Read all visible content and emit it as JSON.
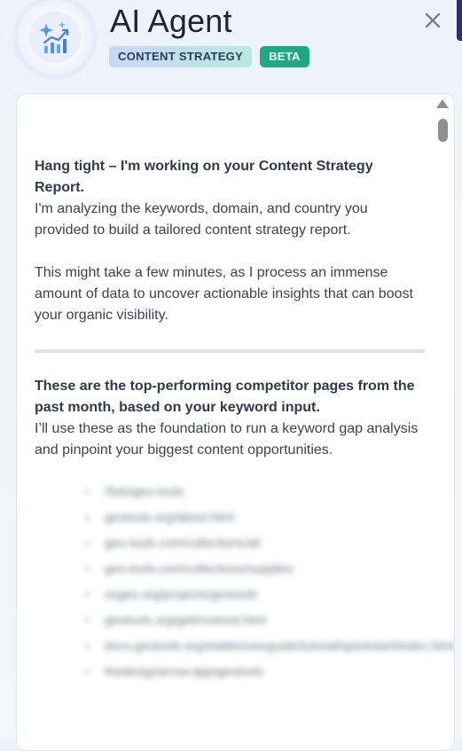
{
  "header": {
    "title": "AI Agent",
    "badge_content": "CONTENT STRATEGY",
    "badge_beta": "BETA",
    "logo_icon": "sparkle-chart-icon",
    "close_icon": "close-icon"
  },
  "message": {
    "heading": "Hang tight – I'm working on your Content Strategy Report.",
    "p1": "I'm analyzing the keywords, domain, and country you provided to build a tailored content strategy report.",
    "p2": "This might take a few minutes, as I process an immense amount of data to uncover actionable insights that can boost your organic visibility.",
    "heading2": "These are the top-performing competitor pages from the past month, based on your keyword input.",
    "p3": "I’ll use these as the foundation to run a keyword gap analysis and pinpoint your biggest content opportunities."
  },
  "competitor_pages": [
    "/lists/geo-tools",
    "geotools.org/about.html",
    "geo-tools.com/collections/all",
    "geo-tools.com/collections/supplies",
    "osgeo.org/projects/geotools",
    "geotools.org/getinvolved.html",
    "docs.geotools.org/stable/userguide/tutorial/quickstart/index.html",
    "thedesignarrow.app/geotools"
  ],
  "colors": {
    "beta": "#1fa883",
    "badge_gradient_start": "#c9d7f5",
    "badge_gradient_end": "#b9e8e1",
    "edge": "#26307a"
  }
}
